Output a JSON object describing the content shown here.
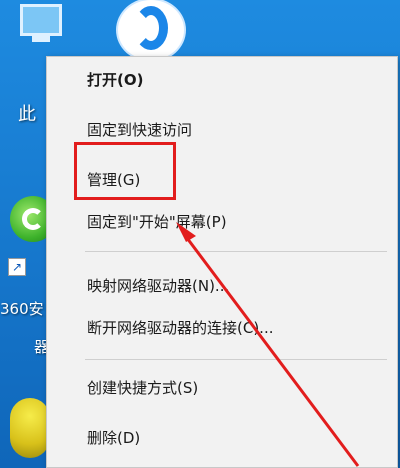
{
  "desktop": {
    "this_pc_label": "此",
    "app_360_label_line1": "360安",
    "app_360_label_line2": "器"
  },
  "context_menu": {
    "items": [
      {
        "label": "打开(O)",
        "bold": true
      },
      {
        "label": "固定到快速访问"
      },
      {
        "label": "管理(G)",
        "highlighted": true
      },
      {
        "label": "固定到\"开始\"屏幕(P)"
      },
      {
        "label": "映射网络驱动器(N)..."
      },
      {
        "label": "断开网络驱动器的连接(C)..."
      },
      {
        "label": "创建快捷方式(S)"
      },
      {
        "label": "删除(D)"
      }
    ]
  },
  "annotation": {
    "highlight_color": "#e21d1d"
  }
}
